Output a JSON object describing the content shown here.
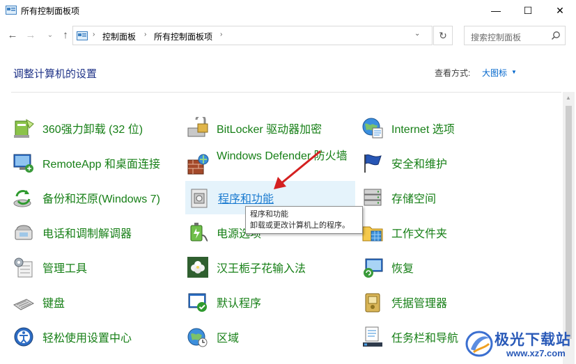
{
  "window": {
    "title": "所有控制面板项",
    "minimize": "—",
    "maximize": "☐",
    "close": "✕"
  },
  "nav": {
    "back": "←",
    "forward": "→",
    "history": "⌄",
    "up": "↑",
    "breadcrumbs": [
      "控制面板",
      "所有控制面板项"
    ],
    "sep": "›",
    "dropdown": "⌄",
    "refresh": "↻",
    "search_placeholder": "搜索控制面板"
  },
  "header": {
    "title": "调整计算机的设置",
    "view_label": "查看方式:",
    "view_value": "大图标",
    "view_caret": "▼"
  },
  "items": [
    {
      "label": "360强力卸载 (32 位)",
      "icon": "uninstall-icon"
    },
    {
      "label": "BitLocker 驱动器加密",
      "icon": "bitlocker-icon"
    },
    {
      "label": "Internet 选项",
      "icon": "internet-options-icon"
    },
    {
      "label": "RemoteApp 和桌面连接",
      "icon": "remoteapp-icon"
    },
    {
      "label": "Windows Defender 防火墙",
      "icon": "firewall-icon"
    },
    {
      "label": "安全和维护",
      "icon": "security-flag-icon"
    },
    {
      "label": "备份和还原(Windows 7)",
      "icon": "backup-icon"
    },
    {
      "label": "程序和功能",
      "icon": "programs-icon"
    },
    {
      "label": "存储空间",
      "icon": "storage-icon"
    },
    {
      "label": "电话和调制解调器",
      "icon": "phone-icon"
    },
    {
      "label": "电源选项",
      "icon": "power-icon"
    },
    {
      "label": "工作文件夹",
      "icon": "work-folders-icon"
    },
    {
      "label": "管理工具",
      "icon": "admin-tools-icon"
    },
    {
      "label": "汉王栀子花输入法",
      "icon": "ime-flower-icon"
    },
    {
      "label": "恢复",
      "icon": "recovery-icon"
    },
    {
      "label": "键盘",
      "icon": "keyboard-icon"
    },
    {
      "label": "默认程序",
      "icon": "default-programs-icon"
    },
    {
      "label": "凭据管理器",
      "icon": "credential-icon"
    },
    {
      "label": "轻松使用设置中心",
      "icon": "ease-of-access-icon"
    },
    {
      "label": "区域",
      "icon": "region-icon"
    },
    {
      "label": "任务栏和导航",
      "icon": "taskbar-icon"
    }
  ],
  "tooltip": {
    "title": "程序和功能",
    "text": "卸载或更改计算机上的程序。"
  },
  "watermark": {
    "name": "极光下载站",
    "url": "www.xz7.com"
  },
  "colors": {
    "link_green": "#167f16",
    "title_blue": "#1e3287",
    "hover_bg": "#e5f3fb",
    "arrow_red": "#d42020"
  }
}
